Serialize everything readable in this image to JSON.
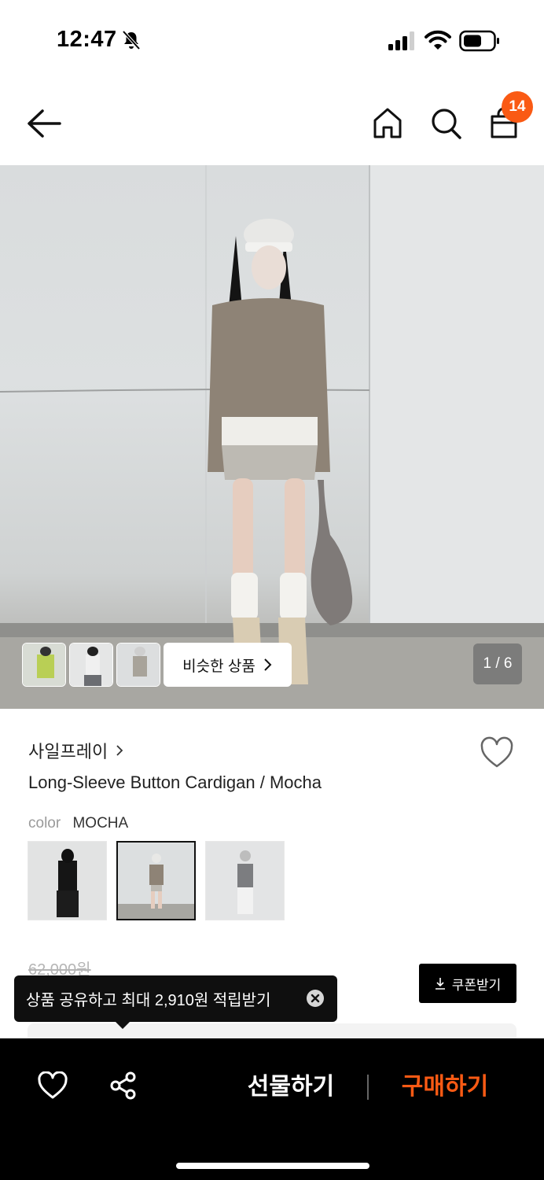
{
  "status_bar": {
    "time": "12:47",
    "icons": [
      "bell-slash-icon",
      "signal-icon",
      "wifi-icon",
      "battery-icon"
    ]
  },
  "nav": {
    "icons": [
      "back-arrow-icon",
      "home-icon",
      "search-icon",
      "shopping-bag-icon"
    ],
    "cart_count": "14",
    "accent_color": "#fa5a14"
  },
  "gallery": {
    "similar_label": "비슷한 상품",
    "page_counter": "1 / 6"
  },
  "product": {
    "brand": "사일프레이",
    "title": "Long-Sleeve Button Cardigan / Mocha",
    "color_label": "color",
    "color_value": "MOCHA",
    "swatches": [
      "black",
      "mocha",
      "grey"
    ],
    "selected_swatch": "mocha",
    "original_price": "62,000원"
  },
  "coupon": {
    "label": "쿠폰받기"
  },
  "tooltip": {
    "text": "상품 공유하고 최대 2,910원 적립받기"
  },
  "bottom_bar": {
    "gift_label": "선물하기",
    "buy_label": "구매하기",
    "buy_color": "#fa5a14"
  }
}
